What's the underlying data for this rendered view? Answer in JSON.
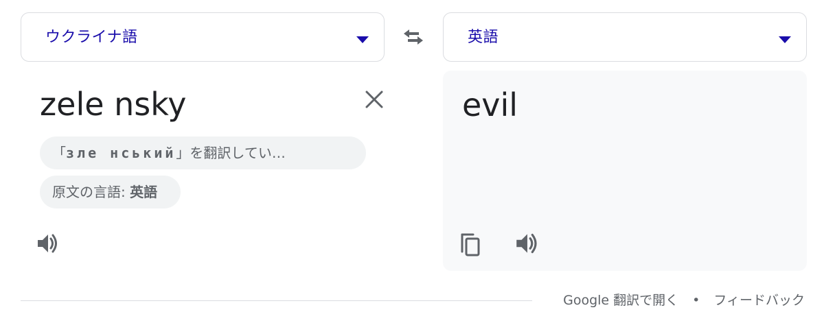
{
  "source_language": {
    "label": "ウクライナ語"
  },
  "target_language": {
    "label": "英語"
  },
  "source": {
    "text": "zele nsky",
    "translating_chip": {
      "open_quote": "「",
      "cyrillic": "зле нський",
      "close_quote": "」",
      "suffix": "を翻訳してい…"
    },
    "detected_chip": {
      "prefix": "原文の言語: ",
      "language": "英語"
    }
  },
  "result": {
    "text": "evil"
  },
  "icons": {
    "swap": "swap-arrows-icon",
    "clear": "close-icon",
    "speaker": "speaker-icon",
    "copy": "copy-icon",
    "caret": "caret-down-icon"
  },
  "footer": {
    "open_link": "Google 翻訳で開く",
    "separator": "•",
    "feedback_link": "フィードバック"
  },
  "colors": {
    "link_blue": "#1a0dab",
    "icon_gray": "#5f6368",
    "chip_bg": "#f1f3f4",
    "panel_bg": "#f8f9fa",
    "border": "#dadce0"
  }
}
